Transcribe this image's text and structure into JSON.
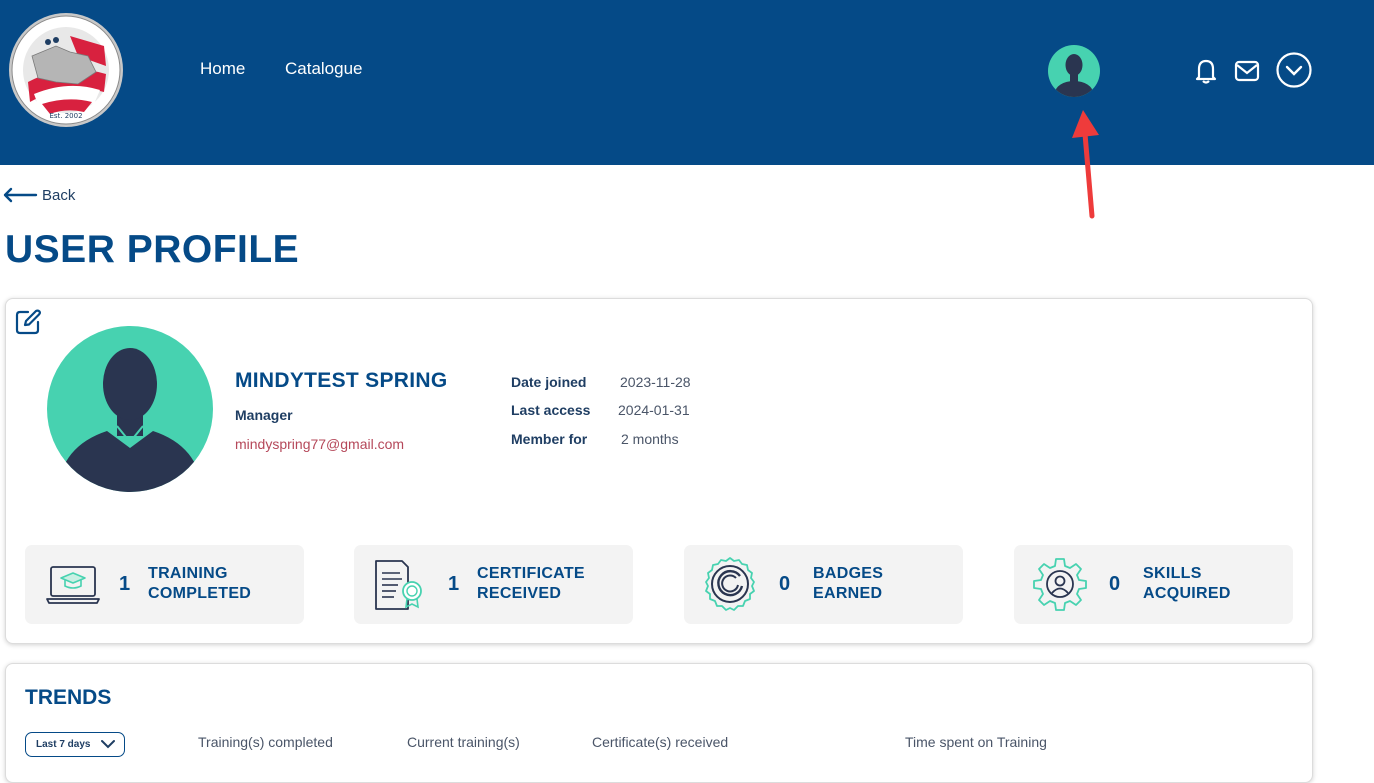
{
  "header": {
    "logo_alt": "Interstate Commission for Adult Offender Supervision Est. 2002",
    "nav": [
      {
        "label": "Home"
      },
      {
        "label": "Catalogue"
      }
    ],
    "icons": [
      "bell-icon",
      "mail-icon",
      "chevron-down-icon"
    ]
  },
  "colors": {
    "header_bg": "#054a87",
    "accent": "#47d2b0",
    "email": "#b5485a",
    "arrow": "#ee3b3b"
  },
  "back": {
    "label": "Back"
  },
  "page": {
    "title": "USER PROFILE"
  },
  "profile": {
    "name": "MINDYTEST SPRING",
    "role": "Manager",
    "email": "mindyspring77@gmail.com",
    "meta": [
      {
        "label": "Date joined",
        "value": "2023-11-28"
      },
      {
        "label": "Last access",
        "value": "2024-01-31"
      },
      {
        "label": "Member for",
        "value": "2 months"
      }
    ]
  },
  "stats": [
    {
      "icon": "laptop-graduation-icon",
      "count": "1",
      "line1": "TRAINING",
      "line2": "COMPLETED"
    },
    {
      "icon": "certificate-icon",
      "count": "1",
      "line1": "CERTIFICATE",
      "line2": "RECEIVED"
    },
    {
      "icon": "badge-icon",
      "count": "0",
      "line1": "BADGES",
      "line2": "EARNED"
    },
    {
      "icon": "skills-gear-icon",
      "count": "0",
      "line1": "SKILLS",
      "line2": "ACQUIRED"
    }
  ],
  "trends": {
    "title": "TRENDS",
    "range": "Last 7 days",
    "columns": [
      {
        "label": "Training(s) completed"
      },
      {
        "label": "Current training(s)"
      },
      {
        "label": "Certificate(s) received"
      },
      {
        "label": "Time spent on Training"
      }
    ]
  }
}
